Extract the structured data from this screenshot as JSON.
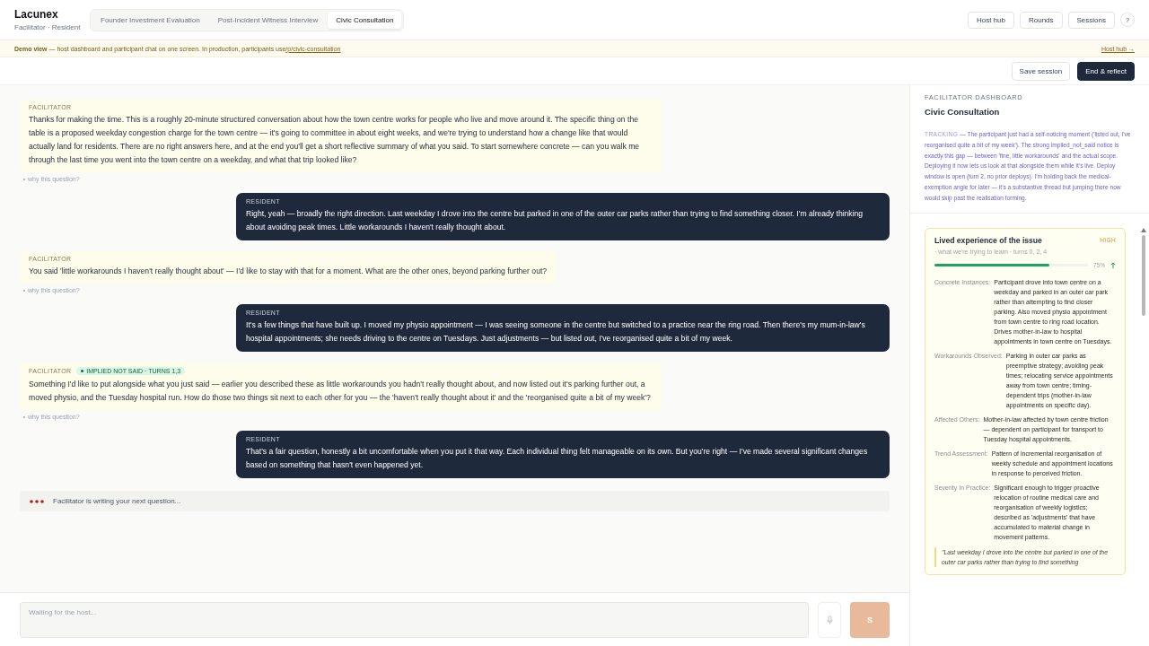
{
  "app": {
    "name": "Lacunex",
    "subtitle": "Facilitator · Resident"
  },
  "tabs": [
    {
      "label": "Founder Investment Evaluation",
      "selected": false
    },
    {
      "label": "Post-Incident Witness Interview",
      "selected": false
    },
    {
      "label": "Civic Consultation",
      "selected": true
    }
  ],
  "nav": [
    "Host hub",
    "Rounds",
    "Sessions",
    "?"
  ],
  "banner": {
    "text": "**Demo view** — host dashboard and participant chat on one screen. In production, participants use ",
    "link": "/p/civic-consultation",
    "right_link": "Host hub →"
  },
  "actions": [
    {
      "label": "Save session",
      "kind": "secondary"
    },
    {
      "label": "End & reflect",
      "kind": "primary"
    }
  ],
  "messages": [
    {
      "kind": "facilitator",
      "speaker": "FACILITATOR",
      "text": "Thanks for making the time. This is a roughly 20-minute structured conversation about how the town centre works for people who live and move around it. The specific thing on the table is a proposed weekday congestion charge for the town centre — it's going to committee in about eight weeks, and we're trying to understand how a change like that would actually land for residents. There are no right answers here, and at the end you'll get a short reflective summary of what you said. To start somewhere concrete — can you walk me through the last time you went into the town centre on a weekday, and what that trip looked like?",
      "why": "why this question?"
    },
    {
      "kind": "resident",
      "speaker": "RESIDENT",
      "text": "Right, yeah — broadly the right direction. Last weekday I drove into the centre but parked in one of the outer car parks rather than trying to find something closer. I'm already thinking about avoiding peak times. Little workarounds I haven't really thought about."
    },
    {
      "kind": "facilitator",
      "speaker": "FACILITATOR",
      "text": "You said 'little workarounds I haven't really thought about' — I'd like to stay with that for a moment. What are the other ones, beyond parking further out?",
      "why": "why this question?"
    },
    {
      "kind": "resident",
      "speaker": "RESIDENT",
      "text": "It's a few things that have built up. I moved my physio appointment — I was seeing someone in the centre but switched to a practice near the ring road. Then there's my mum-in-law's hospital appointments; she needs driving to the centre on Tuesdays. Just adjustments — but listed out, I've reorganised quite a bit of my week."
    },
    {
      "kind": "facilitator",
      "speaker": "FACILITATOR",
      "badge": "IMPLIED NOT SAID · TURNS 1,3",
      "text": "Something I'd like to put alongside what you just said — earlier you described these as little workarounds you hadn't really thought about, and now listed out it's parking further out, a moved physio, and the Tuesday hospital run. How do those two things sit next to each other for you — the 'haven't really thought about it' and the 'reorganised quite a bit of my week'?",
      "why": "why this question?"
    },
    {
      "kind": "resident",
      "speaker": "RESIDENT",
      "text": "That's a fair question, honestly a bit uncomfortable when you put it that way. Each individual thing felt manageable on its own. But you're right — I've made several significant changes based on something that hasn't even happened yet."
    }
  ],
  "typing": "Facilitator is writing your next question...",
  "composer": {
    "placeholder": "Waiting for the host...",
    "send": "S",
    "disabled": true
  },
  "dashboard": {
    "heading": "FACILITATOR DASHBOARD",
    "title": "Civic Consultation",
    "tracking_label": "TRACKING",
    "tracking": "— The participant just had a self-noticing moment ('listed out, I've reorganised quite a bit of my week'). The strong implied_not_said notice is exactly this gap — between 'fine, little workarounds' and the actual scope. Deploying it now lets us look at that alongside them while it's live. Deploy window is open (turn 2, no prior deploys). I'm holding back the medical-exemption angle for later — it's a substantive thread but jumping there now would skip past the realisation forming.",
    "card": {
      "title": "Lived experience of the issue",
      "priority": "HIGH",
      "meta": "· what we're trying to learn · turns 0, 2, 4",
      "level": 0.75,
      "reading": "75%",
      "fields": [
        {
          "label": "Concrete Instances:",
          "value": "Participant drove into town centre on a weekday and parked in an outer car park rather than attempting to find closer parking. Also moved physio appointment from town centre to ring road location. Drives mother-in-law to hospital appointments in town centre on Tuesdays."
        },
        {
          "label": "Workarounds Observed:",
          "value": "Parking in outer car parks as preemptive strategy; avoiding peak times; relocating service appointments away from town centre; timing-dependent trips (mother-in-law appointments on specific day)."
        },
        {
          "label": "Affected Others:",
          "value": "Mother-in-law affected by town centre friction — dependent on participant for transport to Tuesday hospital appointments."
        },
        {
          "label": "Trend Assessment:",
          "value": "Pattern of incremental reorganisation of weekly schedule and appointment locations in response to perceived friction."
        },
        {
          "label": "Severity In Practice:",
          "value": "Significant enough to trigger proactive relocation of routine medical care and reorganisation of weekly logistics; described as 'adjustments' that have accumulated to material change in movement patterns."
        }
      ],
      "quote": "\"Last weekday I drove into the centre but parked in one of the outer car parks rather than trying to find something"
    }
  }
}
